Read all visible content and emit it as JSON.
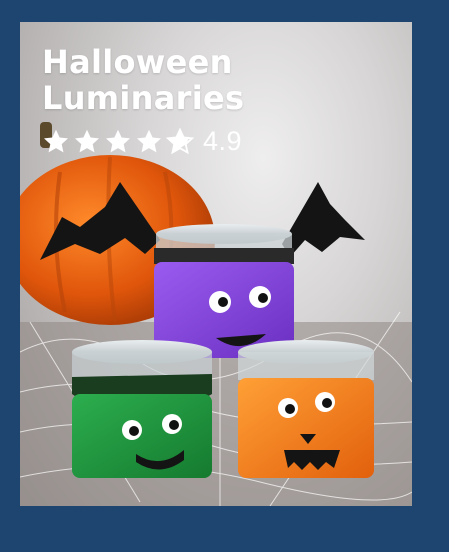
{
  "card": {
    "title_line1": "Halloween",
    "title_line2": "Luminaries",
    "rating": 4.9,
    "rating_text": "4.9",
    "stars_filled": 4.9,
    "stars_total": 5
  },
  "colors": {
    "page_background": "#1e4470",
    "text": "#ffffff",
    "jar_purple": "#7b3fd1",
    "jar_green": "#1f8f3a",
    "jar_orange": "#f07a18",
    "felt_black": "#141414"
  },
  "icons": [
    "star-icon",
    "half-star-icon"
  ]
}
